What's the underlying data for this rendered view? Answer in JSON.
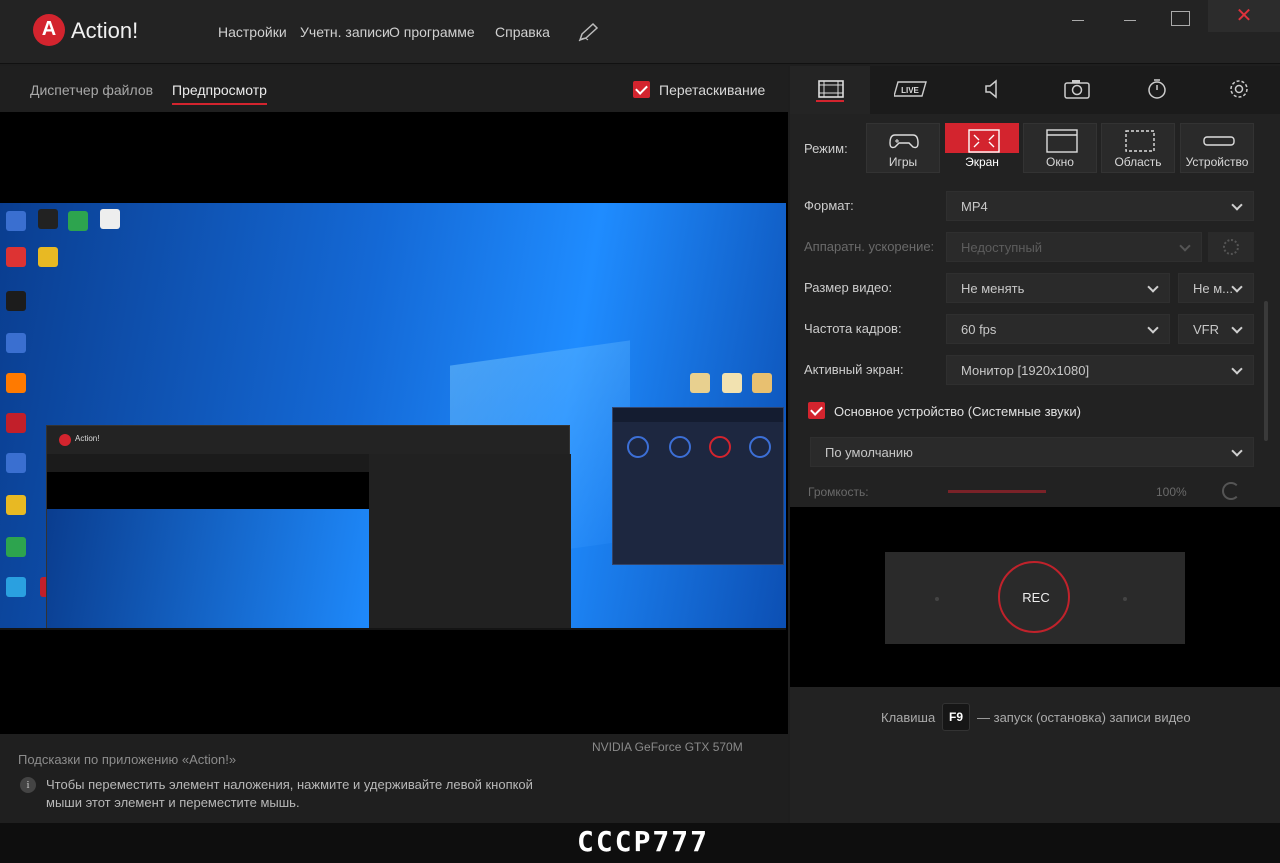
{
  "app": {
    "title": "Action!"
  },
  "menu": [
    "Настройки",
    "Учетн. записи",
    "О программе",
    "Справка"
  ],
  "left": {
    "tabs": [
      "Диспетчер файлов",
      "Предпросмотр"
    ],
    "active_tab": "Предпросмотр",
    "drag_label": "Перетаскивание",
    "gpu": "NVIDIA GeForce GTX 570M",
    "hints_title": "Подсказки по приложению «Action!»",
    "hint_text": "Чтобы переместить элемент наложения, нажмите и удерживайте левой кнопкой мыши этот элемент и переместите мышь."
  },
  "right": {
    "tabs": [
      "video-tab",
      "live-tab",
      "audio-tab",
      "screenshot-tab",
      "timer-tab",
      "settings-tab"
    ],
    "live_label": "LIVE",
    "mode_label": "Режим:",
    "modes": [
      "Игры",
      "Экран",
      "Окно",
      "Область",
      "Устройство"
    ],
    "active_mode": "Экран",
    "format": {
      "label": "Формат:",
      "value": "MP4"
    },
    "hw": {
      "label": "Аппаратн. ускорение:",
      "value": "Недоступный"
    },
    "size": {
      "label": "Размер видео:",
      "value": "Не менять",
      "value2": "Не м..."
    },
    "fps": {
      "label": "Частота кадров:",
      "value": "60 fps",
      "value2": "VFR"
    },
    "screen": {
      "label": "Активный экран:",
      "value": "Монитор [1920x1080]"
    },
    "main_device": "Основное устройство (Системные звуки)",
    "device_value": "По умолчанию",
    "volume_label": "Громкость:",
    "volume_pct": "100%",
    "rec": "REC",
    "hotkey_prefix": "Клавиша",
    "hotkey": "F9",
    "hotkey_suffix": "— запуск (остановка) записи видео"
  },
  "colors": {
    "accent": "#d3242e",
    "bg": "#1e1e1e"
  },
  "watermark": "CCCP777"
}
